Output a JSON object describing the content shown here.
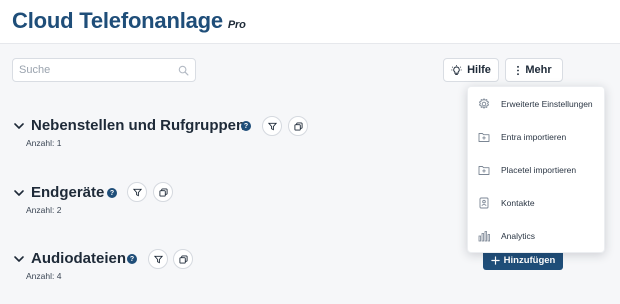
{
  "header": {
    "title": "Cloud Telefonanlage",
    "edition": "Pro"
  },
  "search": {
    "placeholder": "Suche"
  },
  "toolbar": {
    "help_label": "Hilfe",
    "more_label": "Mehr"
  },
  "sections": [
    {
      "title": "Nebenstellen und Rufgruppen",
      "count": "Anzahl: 1"
    },
    {
      "title": "Endgeräte",
      "count": "Anzahl: 2"
    },
    {
      "title": "Audiodateien",
      "count": "Anzahl: 4"
    }
  ],
  "add_button": {
    "label": "Hinzufügen"
  },
  "more_menu": {
    "items": [
      {
        "label": "Erweiterte Einstellungen",
        "icon": "gear-icon"
      },
      {
        "label": "Entra importieren",
        "icon": "folder-import-icon"
      },
      {
        "label": "Placetel importieren",
        "icon": "folder-import-icon"
      },
      {
        "label": "Kontakte",
        "icon": "contact-card-icon"
      },
      {
        "label": "Analytics",
        "icon": "bar-chart-icon"
      }
    ]
  },
  "colors": {
    "brand": "#1f4e79",
    "background": "#f6f7f9",
    "text": "#1e2a38"
  }
}
